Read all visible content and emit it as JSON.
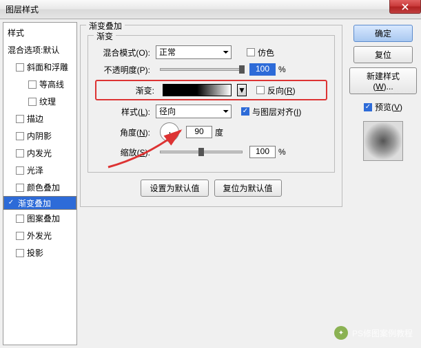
{
  "title": "图层样式",
  "sidebar": {
    "header_style": "样式",
    "header_blend": "混合选项:默认",
    "items": [
      {
        "label": "斜面和浮雕",
        "checked": false
      },
      {
        "label": "等高线",
        "checked": false,
        "sub": true
      },
      {
        "label": "纹理",
        "checked": false,
        "sub": true
      },
      {
        "label": "描边",
        "checked": false
      },
      {
        "label": "内阴影",
        "checked": false
      },
      {
        "label": "内发光",
        "checked": false
      },
      {
        "label": "光泽",
        "checked": false
      },
      {
        "label": "颜色叠加",
        "checked": false
      },
      {
        "label": "渐变叠加",
        "checked": true,
        "selected": true
      },
      {
        "label": "图案叠加",
        "checked": false
      },
      {
        "label": "外发光",
        "checked": false
      },
      {
        "label": "投影",
        "checked": false
      }
    ]
  },
  "panel": {
    "group_title": "渐变叠加",
    "sub_title": "渐变",
    "blend_label": "混合模式(O):",
    "blend_value": "正常",
    "dither_label": "仿色",
    "opacity_label": "不透明度(P):",
    "opacity_value": "100",
    "pct": "%",
    "gradient_label": "渐变:",
    "reverse_label": "反向(R)",
    "style_label": "样式(L):",
    "style_value": "径向",
    "align_label": "与图层对齐(I)",
    "angle_label": "角度(N):",
    "angle_value": "90",
    "deg": "度",
    "scale_label": "缩放(S):",
    "scale_value": "100",
    "btn_default": "设置为默认值",
    "btn_reset": "复位为默认值"
  },
  "right": {
    "ok": "确定",
    "cancel": "复位",
    "new_style": "新建样式(W)...",
    "preview": "预览(V)"
  },
  "watermark": "PS修图案例教程"
}
